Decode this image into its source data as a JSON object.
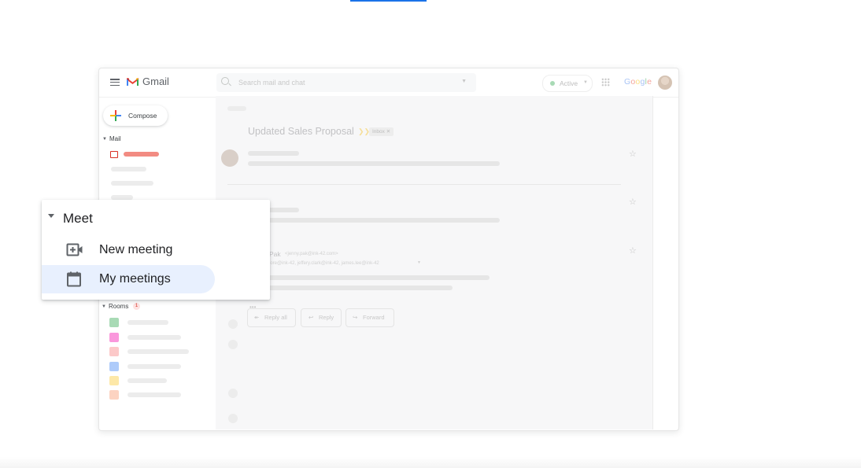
{
  "window": {
    "app_name": "Gmail",
    "search_placeholder": "Search mail and chat",
    "status_label": "Active",
    "google_wordmark": [
      "G",
      "o",
      "o",
      "g",
      "l",
      "e"
    ],
    "google_colors": [
      "#4285f4",
      "#ea4335",
      "#fbbc05",
      "#4285f4",
      "#34a853",
      "#ea4335"
    ]
  },
  "sidebar": {
    "compose_label": "Compose",
    "mail_section": "Mail",
    "rooms_section": "Rooms",
    "rooms_badge": "1",
    "room_colors": [
      "#a8dab5",
      "#fa98dc",
      "#fcc9c9",
      "#aecbfa",
      "#fde8a8",
      "#fcd3c1"
    ]
  },
  "message": {
    "subject": "Updated Sales Proposal",
    "label_chip": "Inbox ✕",
    "count": "9",
    "sender_name": "Pak",
    "sender_email": "<jenny.pak@ink-42.com>",
    "recipients": "...imore@ink-42, jeffery.clark@ink-42, james.lee@ink-42",
    "more": "•••",
    "actions": {
      "reply_all": "Reply all",
      "reply": "Reply",
      "forward": "Forward"
    }
  },
  "meet": {
    "title": "Meet",
    "items": [
      {
        "label": "New meeting",
        "icon": "video-plus-icon",
        "selected": false
      },
      {
        "label": "My meetings",
        "icon": "calendar-icon",
        "selected": true
      }
    ]
  },
  "colors": {
    "selected_bg": "#e8f0fe",
    "accent_blue": "#1a73e8",
    "inbox_red": "#d93025"
  }
}
